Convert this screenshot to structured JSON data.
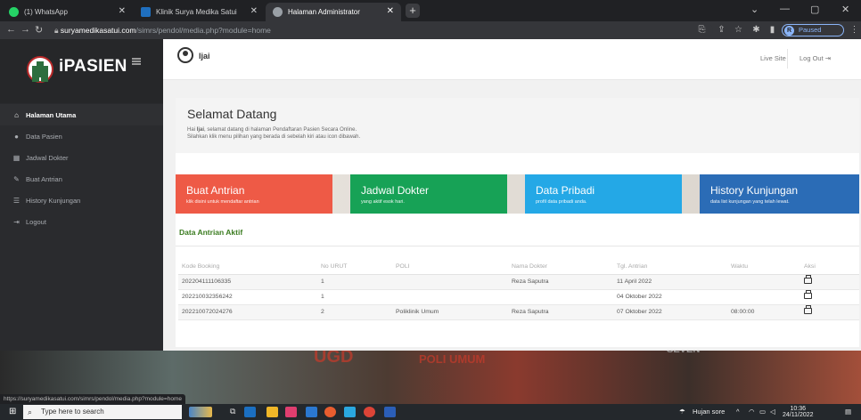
{
  "browser": {
    "tabs": [
      {
        "label": "(1) WhatsApp",
        "active": false,
        "icon": "whatsapp-icon",
        "color": "#25d366"
      },
      {
        "label": "Klinik Surya Medika Satui",
        "active": false,
        "icon": "clinic-icon",
        "color": "#1f6fbf"
      },
      {
        "label": "Halaman Administrator",
        "active": true,
        "icon": "globe-icon",
        "color": "#9aa0a6"
      }
    ],
    "url_domain": "suryamedikasatui.com",
    "url_path": "/simrs/pendol/media.php?module=home",
    "profile_initial": "R",
    "profile_status": "Paused"
  },
  "sidebar": {
    "brand": "iPASIEN",
    "items": [
      {
        "label": "Halaman Utama",
        "icon": "home-icon",
        "active": true
      },
      {
        "label": "Data Pasien",
        "icon": "user-icon",
        "active": false
      },
      {
        "label": "Jadwal Dokter",
        "icon": "calendar-icon",
        "active": false
      },
      {
        "label": "Buat Antrian",
        "icon": "pencil-icon",
        "active": false
      },
      {
        "label": "History Kunjungan",
        "icon": "list-icon",
        "active": false
      },
      {
        "label": "Logout",
        "icon": "logout-icon",
        "active": false
      }
    ]
  },
  "header": {
    "username": "Ijai",
    "live_site": "Live Site",
    "logout": "Log Out"
  },
  "welcome": {
    "title": "Selamat Datang",
    "line1_prefix": "Hai ",
    "line1_name": "Ijai",
    "line1_suffix": ", selamat datang di halaman Pendaftaran Pasien Secara Online.",
    "line2": "Silahkan klik menu pilihan yang berada di sebelah kiri atau icon dibawah."
  },
  "boxes": [
    {
      "title": "Buat Antrian",
      "subtitle": "klik disini untuk mendaftar antrian",
      "color": "#ee5a46"
    },
    {
      "title": "Jadwal Dokter",
      "subtitle": "yang aktif esok hari.",
      "color": "#17a256"
    },
    {
      "title": "Data Pribadi",
      "subtitle": "profil data pribadi anda.",
      "color": "#24a8e6"
    },
    {
      "title": "History Kunjungan",
      "subtitle": "data list kunjungan yang telah lewat.",
      "color": "#2b6cb6"
    }
  ],
  "antrian": {
    "title": "Data Antrian Aktif",
    "columns": [
      "Kode Booking",
      "No URUT",
      "POLI",
      "Nama Dokter",
      "Tgl. Antrian",
      "Waktu",
      "Aksi"
    ],
    "rows": [
      [
        "202204111106335",
        "1",
        "",
        "Reza Saputra",
        "11 April 2022",
        ""
      ],
      [
        "202210032356242",
        "1",
        "",
        "",
        "04 Oktober 2022",
        ""
      ],
      [
        "202210072024276",
        "2",
        "Poliklinik Umum",
        "Reza Saputra",
        "07 Oktober 2022",
        "08:00:00"
      ]
    ]
  },
  "status_url": "https://suryamedikasatui.com/simrs/pendol/media.php?module=home",
  "background_text": {
    "sign1": "UGD",
    "sign2": "POLI UMUM",
    "sign3": "SEVEN"
  },
  "taskbar": {
    "search_placeholder": "Type here to search",
    "weather": "Hujan sore",
    "time": "10:36",
    "date": "24/11/2022"
  },
  "colors": {
    "accent_green": "#3a7b1f",
    "sidebar_bg": "#2a2b2e"
  }
}
